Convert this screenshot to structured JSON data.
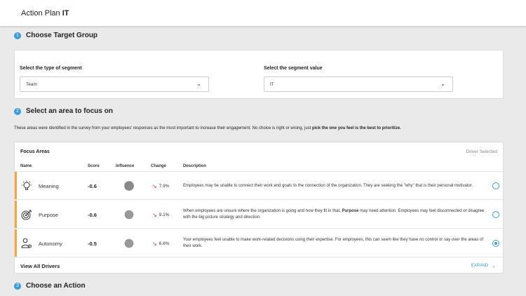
{
  "header": {
    "title_prefix": "Action Plan",
    "title_team": "IT"
  },
  "steps": [
    {
      "num": "1",
      "label": "Choose Target Group"
    },
    {
      "num": "2",
      "label": "Select an area to focus on"
    },
    {
      "num": "3",
      "label": "Choose an Action"
    }
  ],
  "segment": {
    "type_label": "Select the type of segment",
    "type_value": "Team",
    "value_label": "Select the segment value",
    "value_value": "IT"
  },
  "intro": {
    "text": "These areas were identified in the survey from your employees' responses as the most important to increase their engagement.  No choice is right or wrong, just ",
    "bold": "pick the one you feel is the best to prioritize."
  },
  "focus": {
    "title": "Focus Areas",
    "driver_selected": "Driver Selected",
    "columns": {
      "name": "Name",
      "score": "Score",
      "influence": "Influence",
      "change": "Change",
      "description": "Description"
    },
    "rows": [
      {
        "name": "Meaning",
        "icon": "lightbulb-icon",
        "score": "-0.6",
        "change": "7.9%",
        "desc_a": "Employees may be unable to connect their work and goals to the connection of the organization. They are seeking the \"why\" that is their personal motivator.",
        "selected": false
      },
      {
        "name": "Purpose",
        "icon": "target-icon",
        "score": "-0.6",
        "change": "9.1%",
        "desc_a": "When employees are unsure where the organization is going and how they fit in that, ",
        "desc_bold": "Purpose",
        "desc_b": " may need attention. Employees may feel disconnected or disagree with the big picture strategy and direction.",
        "selected": false
      },
      {
        "name": "Autonomy",
        "icon": "person-gear-icon",
        "score": "-0.5",
        "change": "6.6%",
        "desc_a": "Your employees feel unable to make work-related decisions using their expertise. For employees, this can seem like they have no control or say over the areas of their work.",
        "selected": true
      }
    ],
    "view_all": "View All Drivers",
    "expand": "EXPAND"
  },
  "colors": {
    "accent": "#3a9bd6",
    "highlight_bar": "#f2a541",
    "down_arrow": "#d9342b"
  }
}
